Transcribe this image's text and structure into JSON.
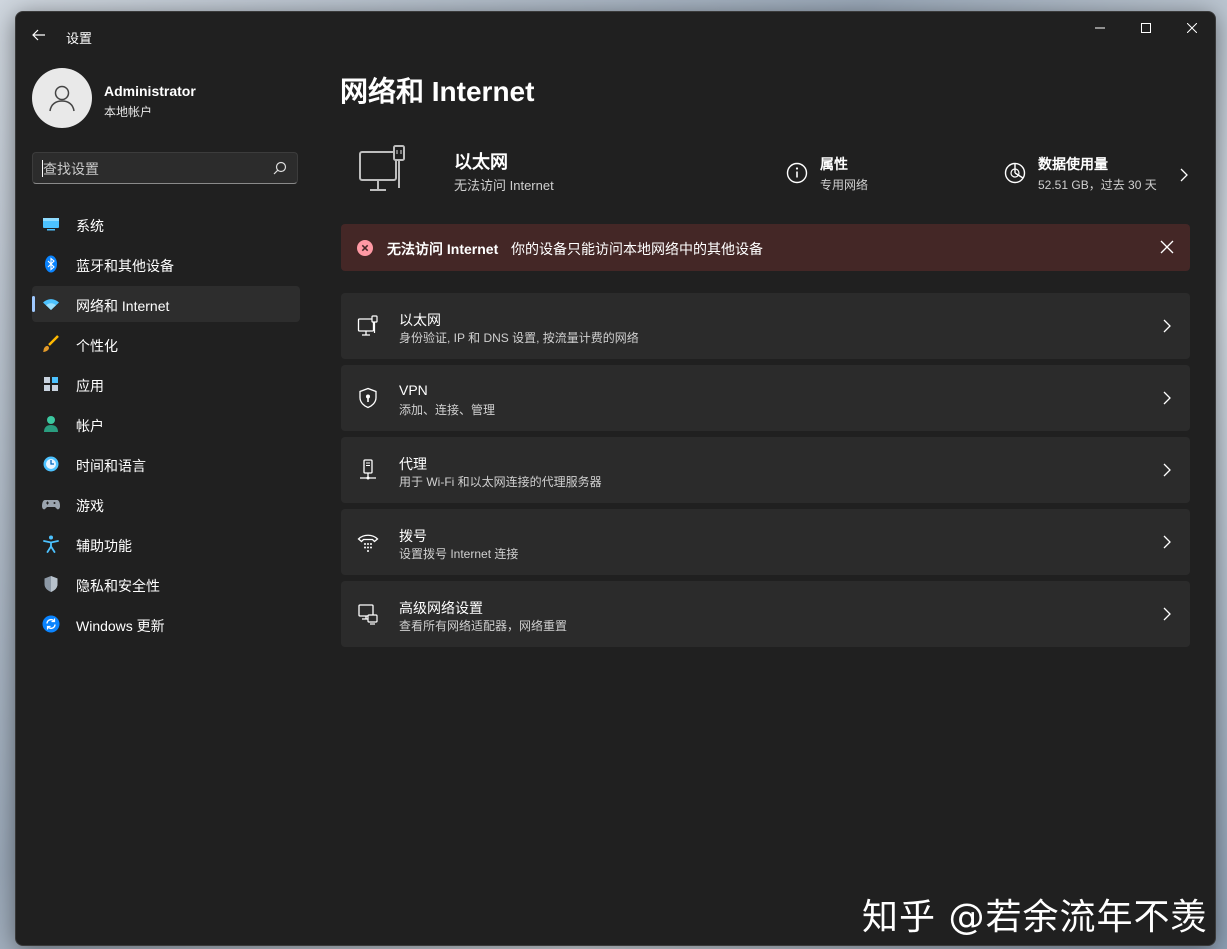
{
  "window": {
    "title": "设置"
  },
  "profile": {
    "name": "Administrator",
    "account_type": "本地帐户"
  },
  "search": {
    "placeholder": "查找设置"
  },
  "sidebar": {
    "items": [
      {
        "label": "系统",
        "icon": "system-icon"
      },
      {
        "label": "蓝牙和其他设备",
        "icon": "bluetooth-icon"
      },
      {
        "label": "网络和 Internet",
        "icon": "wifi-icon",
        "active": true
      },
      {
        "label": "个性化",
        "icon": "brush-icon"
      },
      {
        "label": "应用",
        "icon": "apps-icon"
      },
      {
        "label": "帐户",
        "icon": "account-icon"
      },
      {
        "label": "时间和语言",
        "icon": "time-language-icon"
      },
      {
        "label": "游戏",
        "icon": "gaming-icon"
      },
      {
        "label": "辅助功能",
        "icon": "accessibility-icon"
      },
      {
        "label": "隐私和安全性",
        "icon": "shield-icon"
      },
      {
        "label": "Windows 更新",
        "icon": "update-icon"
      }
    ]
  },
  "main": {
    "title": "网络和 Internet",
    "summary": {
      "adapter_name": "以太网",
      "adapter_status": "无法访问 Internet",
      "properties_title": "属性",
      "properties_sub": "专用网络",
      "data_title": "数据使用量",
      "data_sub": "52.51 GB，过去 30 天"
    },
    "banner": {
      "title": "无法访问 Internet",
      "message": "你的设备只能访问本地网络中的其他设备"
    },
    "cards": [
      {
        "title": "以太网",
        "subtitle": "身份验证, IP 和 DNS 设置, 按流量计费的网络",
        "icon": "ethernet-icon"
      },
      {
        "title": "VPN",
        "subtitle": "添加、连接、管理",
        "icon": "vpn-shield-icon"
      },
      {
        "title": "代理",
        "subtitle": "用于 Wi-Fi 和以太网连接的代理服务器",
        "icon": "proxy-icon"
      },
      {
        "title": "拨号",
        "subtitle": "设置拨号 Internet 连接",
        "icon": "dialup-icon"
      },
      {
        "title": "高级网络设置",
        "subtitle": "查看所有网络适配器，网络重置",
        "icon": "advanced-network-icon"
      }
    ]
  },
  "watermark": "知乎 @若余流年不羡",
  "colors": {
    "accent": "#9fc9ff",
    "window_bg": "#202020",
    "card_bg": "#2b2b2b",
    "error_bg": "#442726",
    "error_icon": "#ff99a4"
  }
}
